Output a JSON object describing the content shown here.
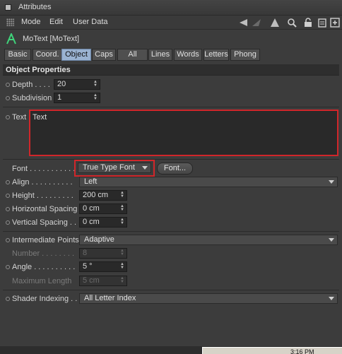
{
  "window": {
    "title": "Attributes"
  },
  "menu": {
    "items": [
      "Mode",
      "Edit",
      "User Data"
    ]
  },
  "object": {
    "name": "MoText [MoText]"
  },
  "tabs": [
    {
      "label": "Basic"
    },
    {
      "label": "Coord."
    },
    {
      "label": "Object"
    },
    {
      "label": "Caps"
    },
    {
      "label": "All"
    },
    {
      "label": "Lines"
    },
    {
      "label": "Words"
    },
    {
      "label": "Letters"
    },
    {
      "label": "Phong"
    }
  ],
  "section": {
    "title": "Object Properties"
  },
  "props": {
    "depth": {
      "label": "Depth . . . .",
      "value": "20"
    },
    "subdivision": {
      "label": "Subdivision",
      "value": "1"
    },
    "text": {
      "label": "Text",
      "value": "Text"
    },
    "font": {
      "label": "Font . . . . . . . . . . .",
      "value": "True Type Font",
      "button": "Font..."
    },
    "align": {
      "label": "Align . . . . . . . . . .",
      "value": "Left"
    },
    "height": {
      "label": "Height . . . . . . . . .",
      "value": "200 cm"
    },
    "hspacing": {
      "label": "Horizontal Spacing",
      "value": "0 cm"
    },
    "vspacing": {
      "label": "Vertical Spacing . .",
      "value": "0 cm"
    },
    "interp": {
      "label": "Intermediate Points",
      "value": "Adaptive"
    },
    "number": {
      "label": "Number . . . . . . . .",
      "value": "8"
    },
    "angle": {
      "label": "Angle . . . . . . . . . .",
      "value": "5 °"
    },
    "maxlen": {
      "label": "Maximum Length",
      "value": "5 cm"
    },
    "shader": {
      "label": "Shader Indexing . .",
      "value": "All Letter Index"
    }
  },
  "status": {
    "clock": "3:16 PM"
  },
  "colors": {
    "highlight": "#d1262a",
    "active_tab": "#9ab3d1"
  }
}
